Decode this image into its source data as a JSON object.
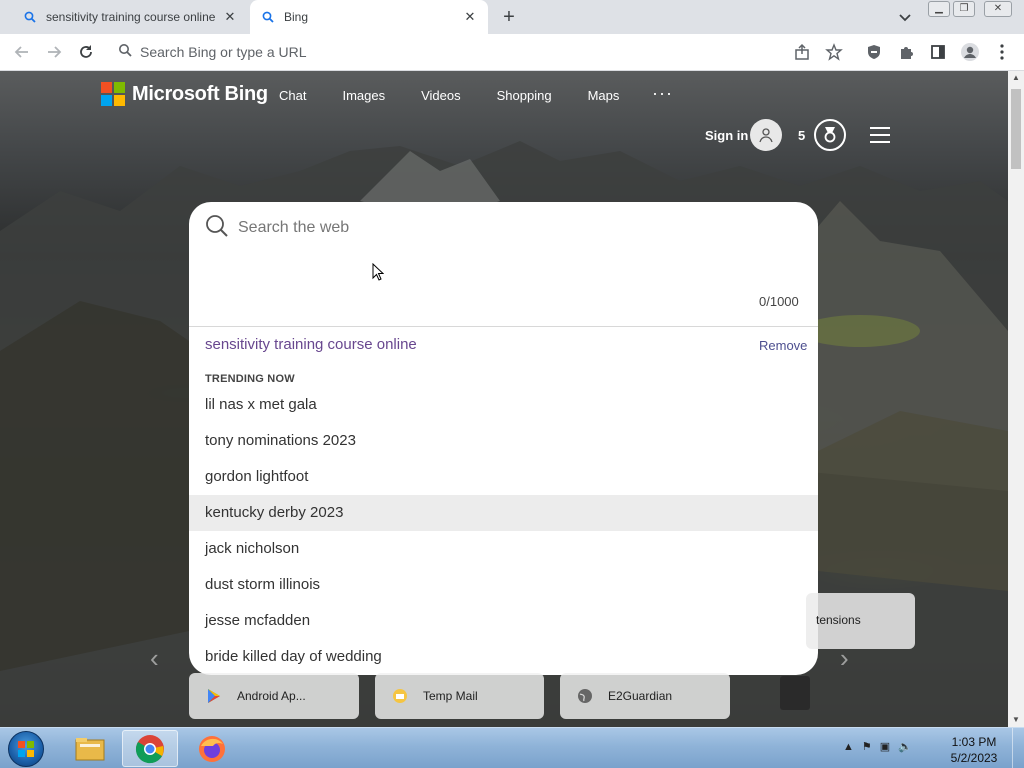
{
  "browser": {
    "tabs": [
      {
        "title": "sensitivity training course online",
        "icon": "search-icon",
        "active": false
      },
      {
        "title": "Bing",
        "icon": "search-icon",
        "active": true
      }
    ],
    "new_tab_symbol": "+",
    "omnibox_placeholder": "Search Bing or type a URL",
    "close_symbol": "✕"
  },
  "bing": {
    "logo_text": "Microsoft Bing",
    "nav": [
      "Chat",
      "Images",
      "Videos",
      "Shopping",
      "Maps"
    ],
    "more": "···",
    "signin": "Sign in",
    "points": "5"
  },
  "search": {
    "placeholder": "Search the web",
    "char_count": "0/1000",
    "history_item": "sensitivity training course online",
    "remove_label": "Remove",
    "trending_label": "TRENDING NOW",
    "suggestions": [
      "lil nas x met gala",
      "tony nominations 2023",
      "gordon lightfoot",
      "kentucky derby 2023",
      "jack nicholson",
      "dust storm illinois",
      "jesse mcfadden",
      "bride killed day of wedding"
    ],
    "highlighted_index": 3
  },
  "tiles": [
    {
      "label": "Android Ap...",
      "icon": "play-store-icon"
    },
    {
      "label": "Temp Mail",
      "icon": "temp-mail-icon"
    },
    {
      "label": "E2Guardian",
      "icon": "globe-icon"
    }
  ],
  "extensions_tile": "tensions",
  "taskbar": {
    "time": "1:03 PM",
    "date": "5/2/2023",
    "apps": [
      "file-explorer-icon",
      "chrome-icon",
      "firefox-icon"
    ]
  },
  "colors": {
    "history_link": "#68478f",
    "bing_accent": "#174ae4",
    "highlight_row": "#ececec"
  }
}
